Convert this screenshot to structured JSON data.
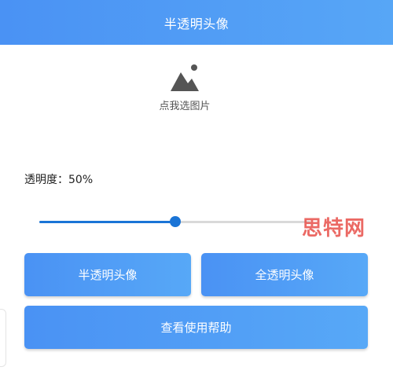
{
  "header": {
    "title": "半透明头像",
    "gradient_start": "#4a92f4",
    "gradient_end": "#57a6f6"
  },
  "picker": {
    "icon": "image-icon",
    "label": "点我选图片"
  },
  "opacity": {
    "label": "透明度：50%",
    "value_percent": 50
  },
  "slider": {
    "value": 0.5,
    "fill_color": "#1a74d6",
    "track_color": "#d9d9d9"
  },
  "buttons": {
    "semi_transparent": "半透明头像",
    "full_transparent": "全透明头像",
    "help": "查看使用帮助"
  },
  "watermark": {
    "text": "思特网",
    "color": "#e8504a"
  }
}
